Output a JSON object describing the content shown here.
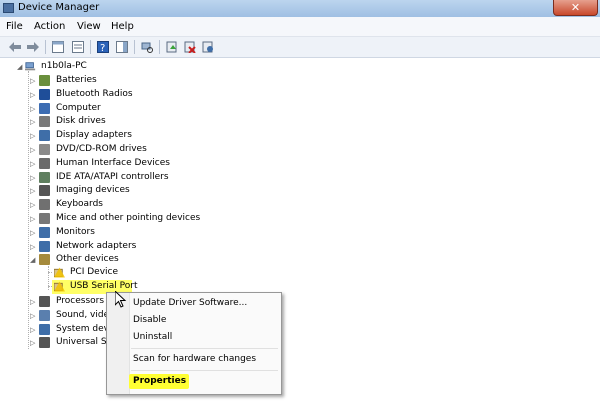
{
  "window": {
    "title": "Device Manager",
    "close_glyph": "✕"
  },
  "menu": {
    "items": [
      "File",
      "Action",
      "View",
      "Help"
    ]
  },
  "toolbar": {
    "icons": [
      "back-arrow-icon",
      "forward-arrow-icon",
      "show-hide-tree-icon",
      "properties-icon",
      "help-icon",
      "action-pane-icon",
      "scan-hardware-icon",
      "update-driver-icon",
      "disable-device-icon",
      "uninstall-device-icon"
    ]
  },
  "tree": {
    "root": "n1b0la-PC",
    "categories": [
      {
        "label": "Batteries",
        "icon": "battery-icon",
        "color": "#6a8f3c"
      },
      {
        "label": "Bluetooth Radios",
        "icon": "bluetooth-icon",
        "color": "#1f4e99"
      },
      {
        "label": "Computer",
        "icon": "computer-icon",
        "color": "#3d6db3"
      },
      {
        "label": "Disk drives",
        "icon": "disk-drive-icon",
        "color": "#7a7a7a"
      },
      {
        "label": "Display adapters",
        "icon": "display-adapter-icon",
        "color": "#3f6ea8"
      },
      {
        "label": "DVD/CD-ROM drives",
        "icon": "dvd-drive-icon",
        "color": "#8a8a8a"
      },
      {
        "label": "Human Interface Devices",
        "icon": "hid-icon",
        "color": "#6a6a6a"
      },
      {
        "label": "IDE ATA/ATAPI controllers",
        "icon": "ide-controller-icon",
        "color": "#5f7f5f"
      },
      {
        "label": "Imaging devices",
        "icon": "imaging-device-icon",
        "color": "#555555"
      },
      {
        "label": "Keyboards",
        "icon": "keyboard-icon",
        "color": "#707070"
      },
      {
        "label": "Mice and other pointing devices",
        "icon": "mouse-icon",
        "color": "#777777"
      },
      {
        "label": "Monitors",
        "icon": "monitor-icon",
        "color": "#3f6ea8"
      },
      {
        "label": "Network adapters",
        "icon": "network-adapter-icon",
        "color": "#3f6ea8"
      },
      {
        "label": "Other devices",
        "icon": "unknown-device-icon",
        "color": "#a58a3c"
      }
    ],
    "other_devices_children": [
      {
        "label": "PCI Device",
        "icon": "warning-device-icon"
      },
      {
        "label": "USB Serial Port",
        "icon": "warning-device-icon"
      }
    ],
    "after": [
      {
        "label": "Processors",
        "icon": "processor-icon",
        "color": "#555555"
      },
      {
        "label": "Sound, video",
        "icon": "sound-icon",
        "color": "#5a7fae"
      },
      {
        "label": "System devi",
        "icon": "system-device-icon",
        "color": "#3f6ea8"
      },
      {
        "label": "Universal Ser",
        "icon": "usb-controller-icon",
        "color": "#555555"
      }
    ]
  },
  "context_menu": {
    "items": [
      "Update Driver Software...",
      "Disable",
      "Uninstall",
      "Scan for hardware changes",
      "Properties"
    ]
  },
  "colors": {
    "highlight": "#ffff66"
  }
}
